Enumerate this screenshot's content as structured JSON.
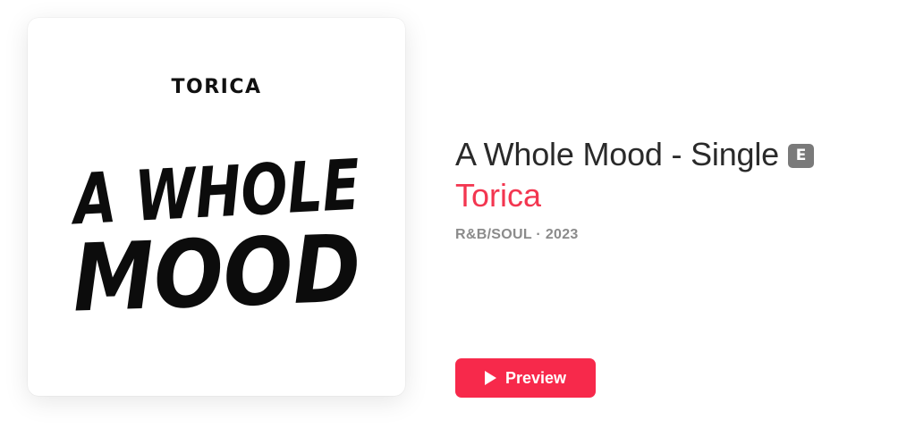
{
  "album": {
    "artwork": {
      "artist_text": "TORICA",
      "title_line1": "A WHOLE",
      "title_line2": "MOOD"
    },
    "title": "A Whole Mood - Single",
    "explicit_badge": "E",
    "artist": "Torica",
    "genre": "R&B/SOUL",
    "separator": "·",
    "year": "2023"
  },
  "actions": {
    "preview_label": "Preview",
    "preview_icon": "play-icon"
  },
  "colors": {
    "accent": "#f7294b",
    "artist_link": "#f33650",
    "title": "#2a2a2a",
    "meta": "#8b8b8b",
    "badge": "#7a7a7a"
  }
}
